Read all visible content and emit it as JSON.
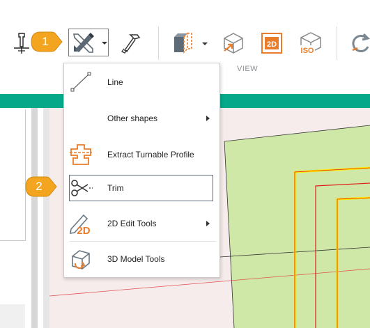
{
  "ribbon": {
    "view_group_label": "VIEW",
    "buttons": [
      {
        "name": "tool-pin",
        "icon": "pin-tool-icon"
      },
      {
        "name": "draw",
        "icon": "pencil-ruler-icon",
        "has_dropdown": true
      },
      {
        "name": "hammer",
        "icon": "hammer-icon"
      },
      {
        "name": "section-view",
        "icon": "section-box-icon",
        "has_dropdown": true
      },
      {
        "name": "view-3d",
        "icon": "cube-arrow-icon"
      },
      {
        "name": "view-2d",
        "icon": "2d-view-icon",
        "text": "2D"
      },
      {
        "name": "view-iso",
        "icon": "iso-view-icon",
        "text": "ISO"
      },
      {
        "name": "refresh",
        "icon": "refresh-icon"
      }
    ]
  },
  "menu": {
    "items": [
      {
        "label": "Line",
        "icon": "line-icon",
        "submenu": false
      },
      {
        "label": "Other shapes",
        "icon": "",
        "submenu": true
      },
      {
        "label": "Extract Turnable Profile",
        "icon": "turnable-profile-icon",
        "submenu": false
      },
      {
        "label": "Trim",
        "icon": "scissors-icon",
        "submenu": false,
        "highlighted": true
      },
      {
        "label": "2D Edit Tools",
        "icon": "2d-edit-icon",
        "submenu": true
      },
      {
        "label": "3D Model Tools",
        "icon": "3d-model-icon",
        "submenu": false
      }
    ]
  },
  "callouts": [
    "1",
    "2"
  ],
  "colors": {
    "accent_teal": "#05a98a",
    "callout_orange": "#f3a51f",
    "icon_orange": "#e97d2b",
    "canvas_pink": "#f7ecec",
    "part_green": "#cfe8a8",
    "profile_yellow": "#ffe800",
    "profile_red": "#e0201f"
  }
}
